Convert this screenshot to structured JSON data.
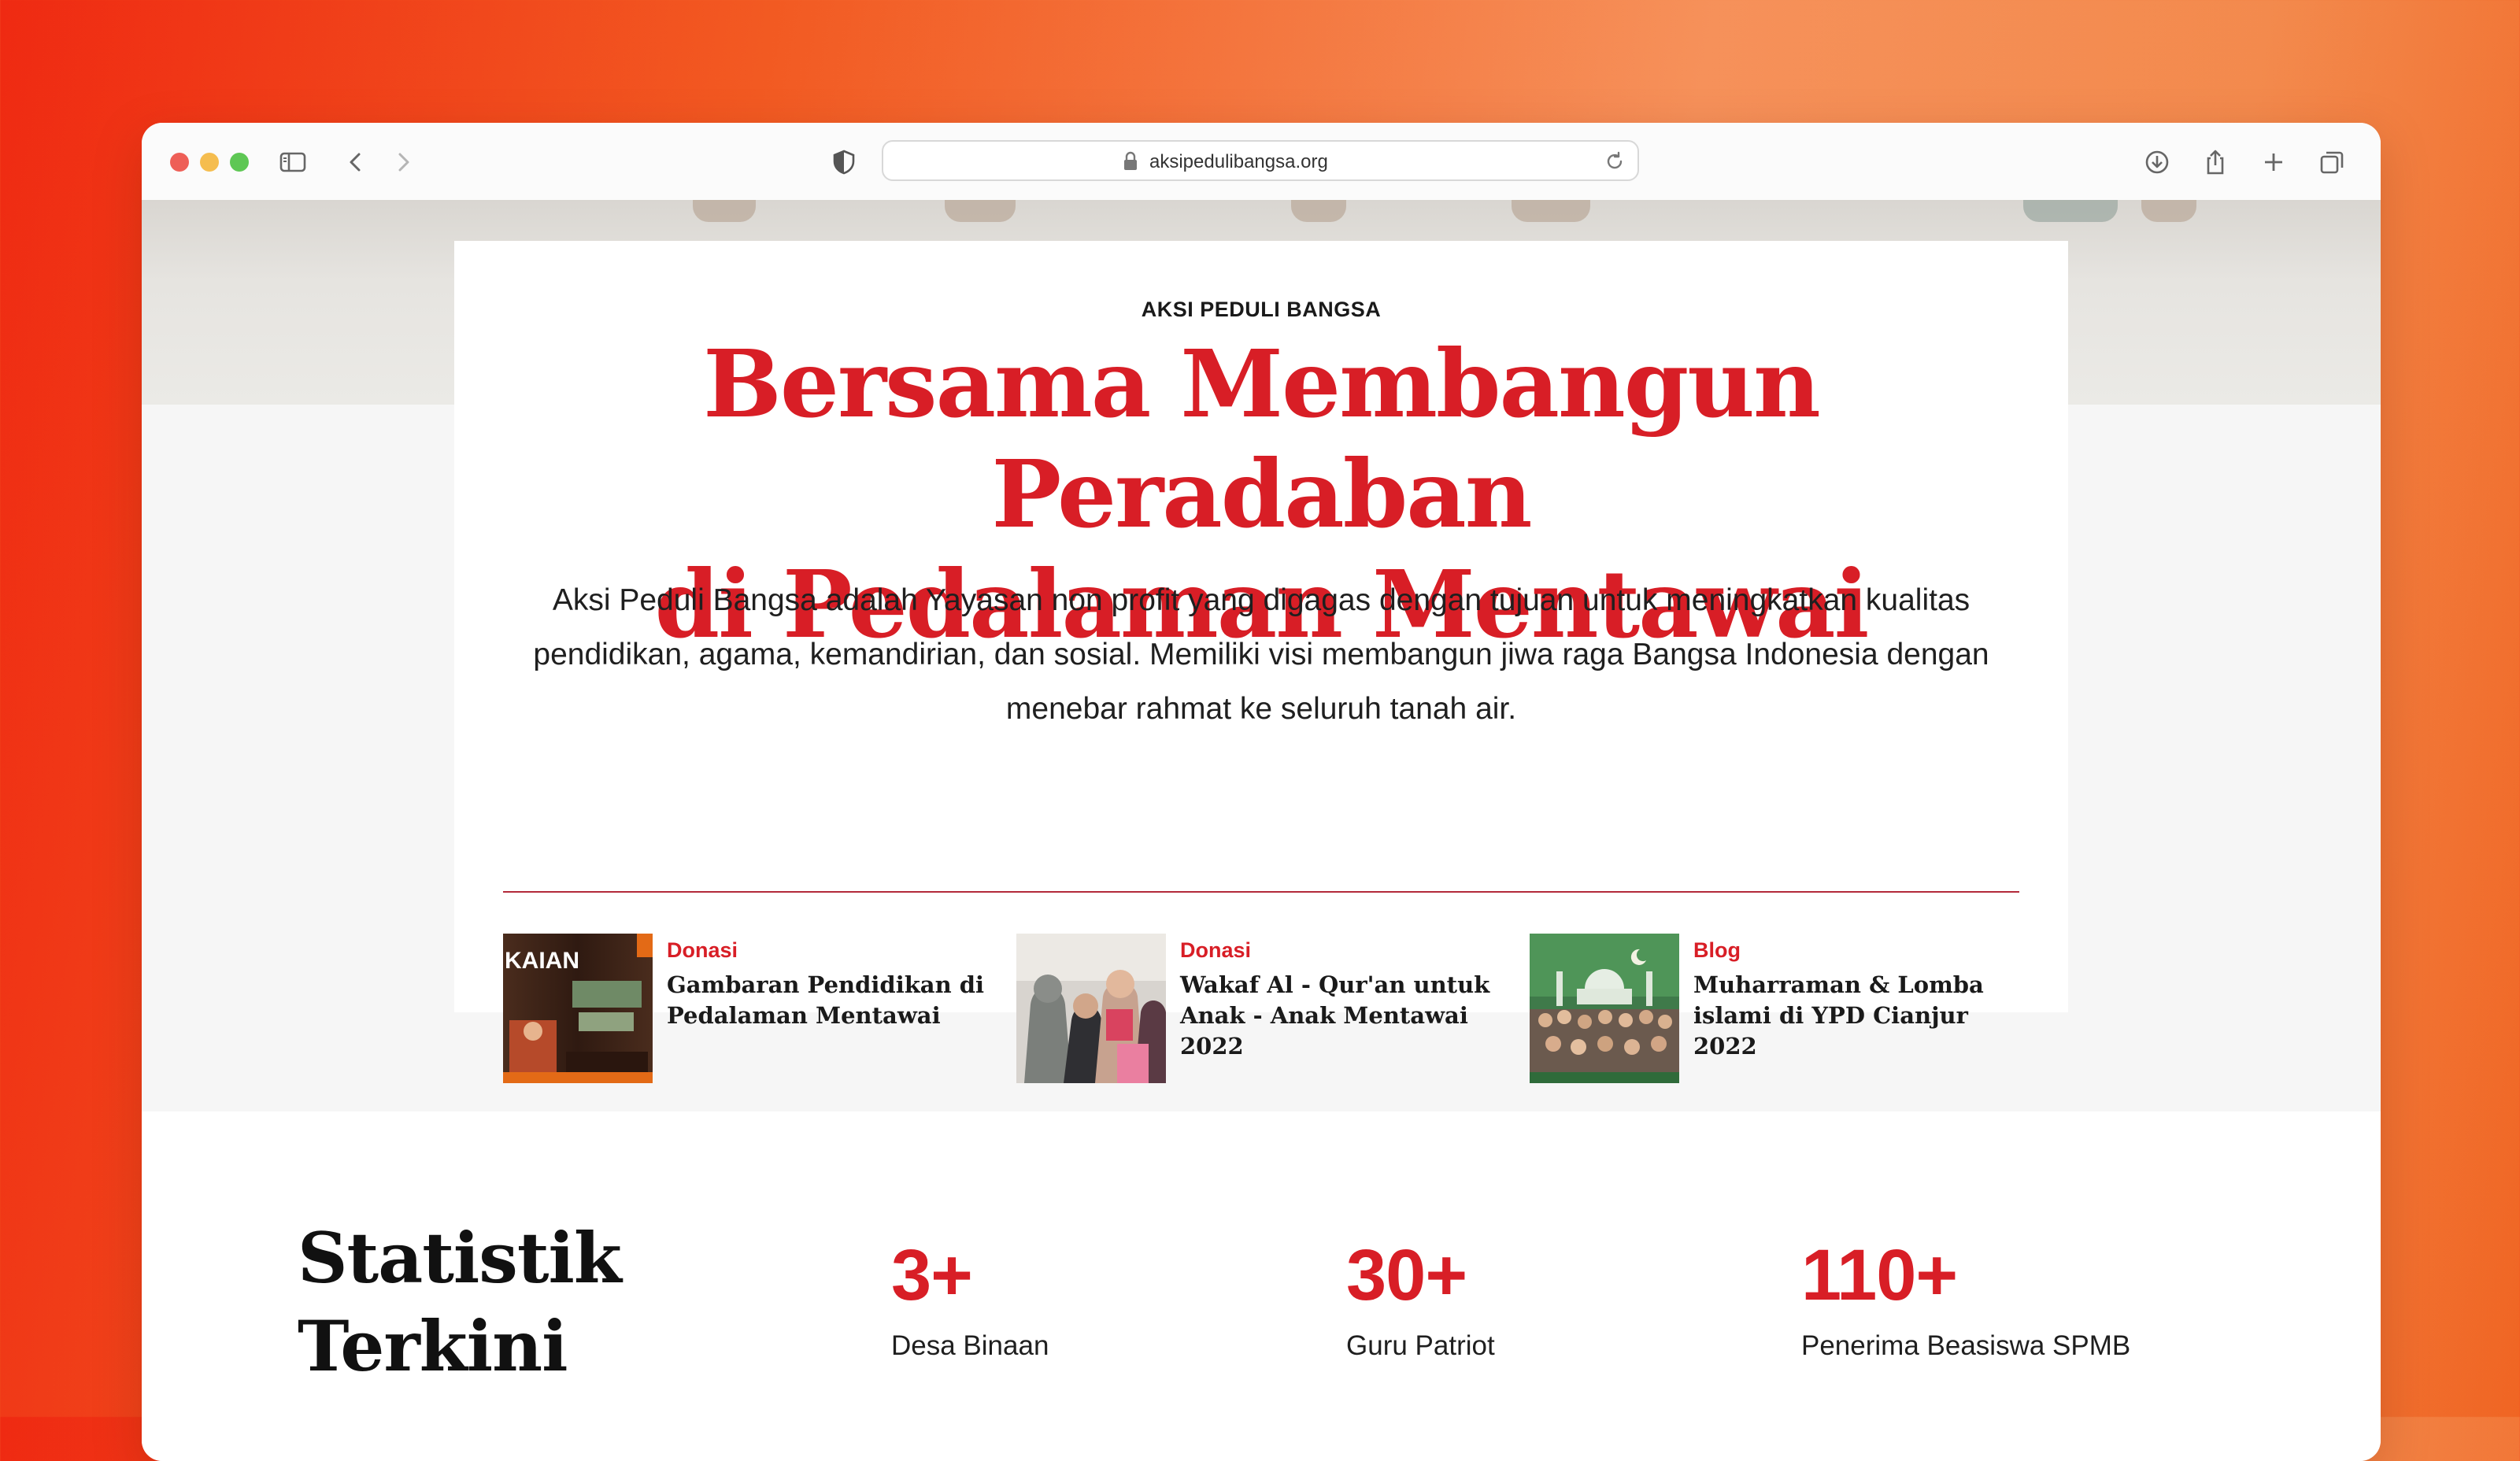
{
  "browser": {
    "url": "aksipedulibangsa.org"
  },
  "hero": {
    "eyebrow": "AKSI PEDULI BANGSA",
    "headline_line1": "Bersama Membangun Peradaban",
    "headline_line2": "di Pedalaman Mentawai",
    "description": "Aksi Peduli Bangsa adalah Yayasan non profit yang digagas dengan tujuan untuk meningkatkan kualitas pendidikan, agama, kemandirian, dan sosial. Memiliki visi membangun jiwa raga Bangsa Indonesia dengan menebar rahmat ke seluruh tanah air."
  },
  "posts": [
    {
      "category": "Donasi",
      "title": "Gambaran Pendidikan di Pedalaman Mentawai",
      "thumb_text": "KAIAN"
    },
    {
      "category": "Donasi",
      "title": "Wakaf Al - Qur'an untuk Anak - Anak Mentawai 2022"
    },
    {
      "category": "Blog",
      "title": "Muharraman & Lomba islami di YPD Cianjur 2022"
    }
  ],
  "stats": {
    "heading_line1": "Statistik",
    "heading_line2": "Terkini",
    "items": [
      {
        "value": "3+",
        "label": "Desa Binaan"
      },
      {
        "value": "30+",
        "label": "Guru Patriot"
      },
      {
        "value": "110+",
        "label": "Penerima Beasiswa SPMB"
      }
    ]
  },
  "colors": {
    "accent": "#d81e26",
    "divider": "#b32a3a"
  }
}
